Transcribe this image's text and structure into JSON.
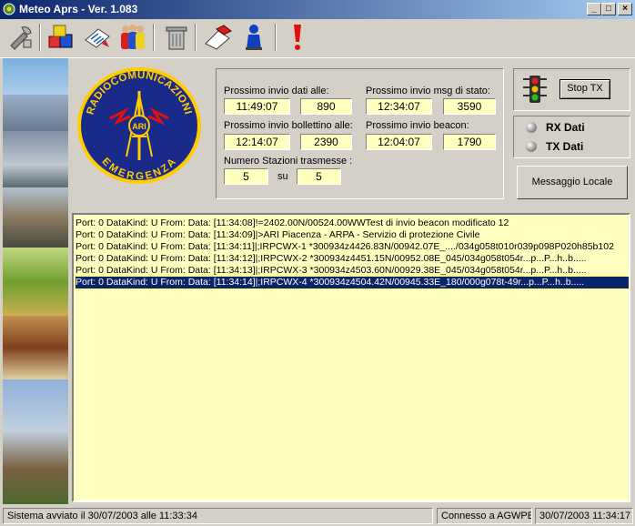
{
  "window": {
    "title": "Meteo Aprs - Ver. 1.083",
    "buttons": {
      "minimize": "_",
      "maximize": "□",
      "close": "×"
    }
  },
  "toolbar": {
    "icons": [
      "tools-icon",
      "cubes-icon",
      "report-icon",
      "users-icon",
      "trash-icon",
      "eraser-icon",
      "person-icon",
      "alert-icon"
    ]
  },
  "logo": {
    "text_top": "RADIOCOMUNICAZIONI",
    "text_bottom": "EMERGENZA",
    "emblem": "ARI"
  },
  "info": {
    "prossimo_dati_label": "Prossimo invio dati alle:",
    "prossimo_dati_time": "11:49:07",
    "prossimo_dati_count": "890",
    "prossimo_msg_label": "Prossimo invio msg di stato:",
    "prossimo_msg_time": "12:34:07",
    "prossimo_msg_count": "3590",
    "prossimo_bollettino_label": "Prossimo invio bollettino alle:",
    "prossimo_bollettino_time": "12:14:07",
    "prossimo_bollettino_count": "2390",
    "prossimo_beacon_label": "Prossimo invio beacon:",
    "prossimo_beacon_time": "12:04:07",
    "prossimo_beacon_count": "1790",
    "stazioni_label": "Numero Stazioni trasmesse :",
    "stazioni_value": "5",
    "su_label": "su",
    "stazioni_total": "5"
  },
  "controls": {
    "stop_tx": "Stop TX",
    "rx_label": "RX Dati",
    "tx_label": "TX Dati",
    "messaggio_locale": "Messaggio Locale"
  },
  "log": [
    "Port: 0 DataKind: U From:  Data: [11:34:08]!=2402.00N/00524.00WWTest di invio beacon modificato 12",
    "Port: 0 DataKind: U From:  Data: [11:34:09]|>ARI Piacenza - ARPA  - Servizio di protezione Civile",
    "Port: 0 DataKind: U From:  Data: [11:34:11]|;IRPCWX-1 *300934z4426.83N/00942.07E_..../034g058t010r039p098P020h85b102",
    "Port: 0 DataKind: U From:  Data: [11:34:12]|;IRPCWX-2 *300934z4451.15N/00952.08E_045/034g058t054r...p...P...h..b.....",
    "Port: 0 DataKind: U From:  Data: [11:34:13]|;IRPCWX-3 *300934z4503.60N/00929.38E_045/034g058t054r...p...P...h..b.....",
    "Port: 0 DataKind: U From:  Data: [11:34:14]|;IRPCWX-4 *300934z4504.42N/00945.33E_180/000g078t-49r...p...P...h..b....."
  ],
  "status": {
    "avviato": "Sistema avviato il 30/07/2003 alle 11:33:34",
    "connesso": "Connesso a AGWPE",
    "datetime": "30/07/2003 11:34:17"
  }
}
